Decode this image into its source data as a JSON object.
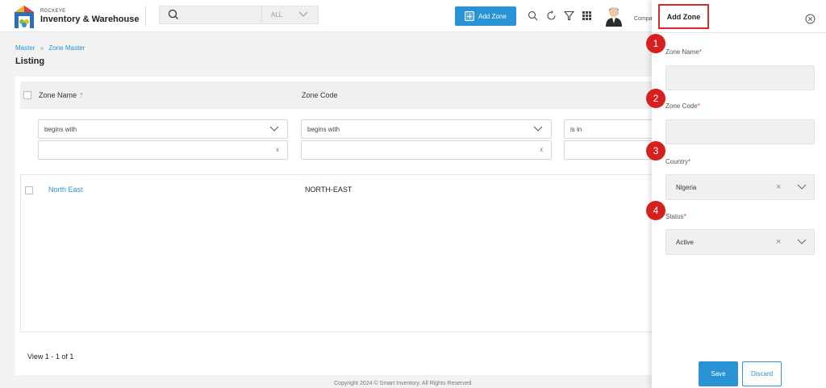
{
  "header": {
    "brand_small": "ROCKEYE",
    "brand_name": "Inventory & Warehouse",
    "search": {
      "scope": "ALL",
      "value": ""
    },
    "add_zone_label": "Add Zone",
    "company_label": "Compa",
    "icons": [
      "search-icon",
      "refresh-icon",
      "filter-icon",
      "apps-grid-icon",
      "user-avatar"
    ]
  },
  "breadcrumb": [
    "Master",
    "Zone Master"
  ],
  "page_title": "Listing",
  "table": {
    "columns": [
      "Zone Name",
      "Zone Code"
    ],
    "filters": [
      {
        "operator": "begins with",
        "value": ""
      },
      {
        "operator": "begins with",
        "value": ""
      },
      {
        "operator": "is in",
        "value": ""
      }
    ],
    "rows": [
      {
        "zone_name": "North East",
        "zone_code": "NORTH-EAST"
      }
    ],
    "pager": "View 1 - 1 of 1"
  },
  "footer": {
    "copyright": "Copyright 2024 © Smart Inventory. All Rights Reserved"
  },
  "panel": {
    "title": "Add Zone",
    "fields": [
      {
        "badge": "1",
        "label": "Zone Name",
        "required": "*",
        "value": ""
      },
      {
        "badge": "2",
        "label": "Zone Code",
        "required": "*",
        "value": ""
      },
      {
        "badge": "3",
        "label": "Country",
        "required": "*",
        "value": "Nigeria"
      },
      {
        "badge": "4",
        "label": "Status",
        "required": "*",
        "value": "Active"
      }
    ],
    "save_label": "Save",
    "discard_label": "Discard"
  },
  "colors": {
    "accent": "#2a93d6",
    "highlight": "#d62b2b",
    "badge": "#d61f1f"
  }
}
